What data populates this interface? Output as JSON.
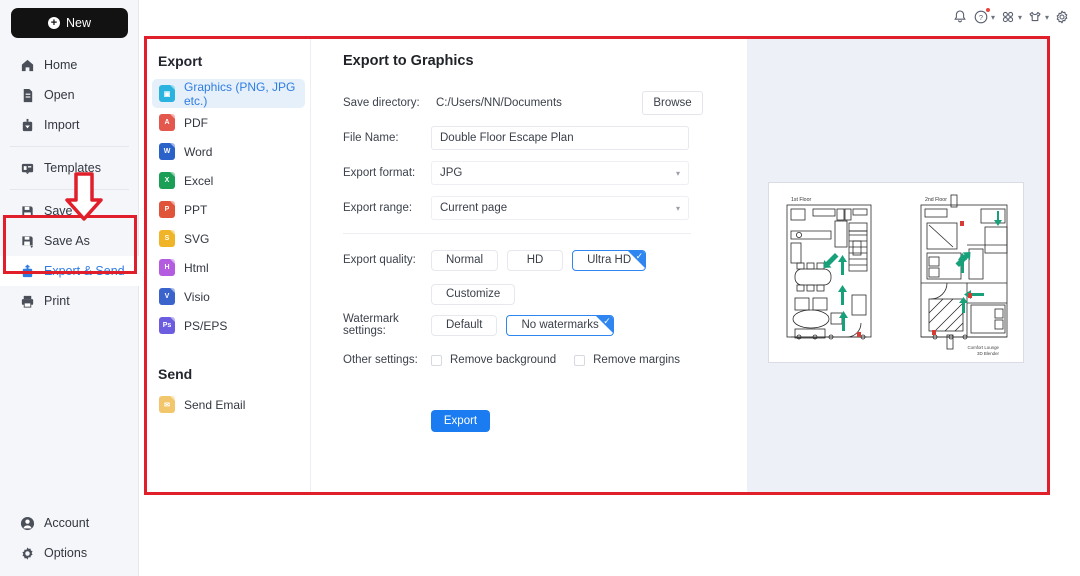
{
  "sidebar": {
    "new_button": {
      "label": "New",
      "icon": "plus-circle-icon"
    },
    "groups": [
      {
        "items": [
          {
            "label": "Home",
            "icon": "home-icon"
          },
          {
            "label": "Open",
            "icon": "file-open-icon"
          },
          {
            "label": "Import",
            "icon": "import-icon"
          }
        ]
      },
      {
        "items": [
          {
            "label": "Templates",
            "icon": "templates-icon"
          }
        ]
      },
      {
        "items": [
          {
            "label": "Save",
            "icon": "save-icon"
          },
          {
            "label": "Save As",
            "icon": "save-as-icon"
          },
          {
            "label": "Export & Send",
            "icon": "export-send-icon",
            "active": true
          },
          {
            "label": "Print",
            "icon": "printer-icon"
          }
        ]
      }
    ],
    "bottom_items": [
      {
        "label": "Account",
        "icon": "account-icon"
      },
      {
        "label": "Options",
        "icon": "options-gear-icon"
      }
    ]
  },
  "topbar": {
    "items": [
      {
        "icon": "bell-icon",
        "caret": false,
        "badge": false
      },
      {
        "icon": "help-circle-icon",
        "caret": true,
        "badge": true
      },
      {
        "icon": "apps-grid-icon",
        "caret": true,
        "badge": false
      },
      {
        "icon": "theme-shirt-icon",
        "caret": true,
        "badge": false
      },
      {
        "icon": "settings-gear-icon",
        "caret": false,
        "badge": false
      }
    ]
  },
  "dialog": {
    "export_section_title": "Export",
    "send_section_title": "Send",
    "export_items": [
      {
        "label": "Graphics (PNG, JPG etc.)",
        "icon": "image-file-icon",
        "color": "#2bb3e0",
        "glyph": "",
        "active": true
      },
      {
        "label": "PDF",
        "icon": "pdf-file-icon",
        "color": "#e4574c",
        "glyph": "A"
      },
      {
        "label": "Word",
        "icon": "word-file-icon",
        "color": "#2b62c9",
        "glyph": "W"
      },
      {
        "label": "Excel",
        "icon": "excel-file-icon",
        "color": "#1b9e56",
        "glyph": "X"
      },
      {
        "label": "PPT",
        "icon": "ppt-file-icon",
        "color": "#e0543a",
        "glyph": "P"
      },
      {
        "label": "SVG",
        "icon": "svg-file-icon",
        "color": "#f0b429",
        "glyph": "S"
      },
      {
        "label": "Html",
        "icon": "html-file-icon",
        "color": "#b45ce0",
        "glyph": "H"
      },
      {
        "label": "Visio",
        "icon": "visio-file-icon",
        "color": "#3b63cc",
        "glyph": "V"
      },
      {
        "label": "PS/EPS",
        "icon": "ps-eps-file-icon",
        "color": "#6b5ce0",
        "glyph": "Ps"
      }
    ],
    "send_items": [
      {
        "label": "Send Email",
        "icon": "email-icon",
        "color": "#f2c76b",
        "glyph": ""
      }
    ],
    "form": {
      "title": "Export to Graphics",
      "save_directory": {
        "label": "Save directory:",
        "value": "C:/Users/NN/Documents",
        "browse_label": "Browse"
      },
      "file_name": {
        "label": "File Name:",
        "value": "Double Floor Escape Plan",
        "placeholder": "File name"
      },
      "export_format": {
        "label": "Export format:",
        "value": "JPG"
      },
      "export_range": {
        "label": "Export range:",
        "value": "Current page"
      },
      "export_quality": {
        "label": "Export quality:",
        "options": [
          "Normal",
          "HD",
          "Ultra HD"
        ],
        "selected": "Ultra HD",
        "customize_label": "Customize"
      },
      "watermark_settings": {
        "label": "Watermark settings:",
        "options": [
          "Default",
          "No watermarks"
        ],
        "selected": "No watermarks"
      },
      "other_settings": {
        "label": "Other settings:",
        "checkboxes": [
          {
            "label": "Remove background",
            "checked": false
          },
          {
            "label": "Remove margins",
            "checked": false
          }
        ]
      },
      "export_button": "Export"
    },
    "preview": {
      "floor1_label": "1st Floor",
      "floor2_label": "2nd Floor",
      "credit_line1": "Comfort Lounge",
      "credit_line2": "3D Blender"
    }
  },
  "annotation": {
    "highlight_color": "#e01f2a",
    "arrow_icon": "down-arrow-annotation"
  },
  "colors": {
    "accent_blue": "#1a7cf0",
    "link_blue": "#2f7de1",
    "sidebar_bg": "#f5f6fa",
    "preview_bg": "#eef0f8",
    "annotation_red": "#e01f2a"
  }
}
